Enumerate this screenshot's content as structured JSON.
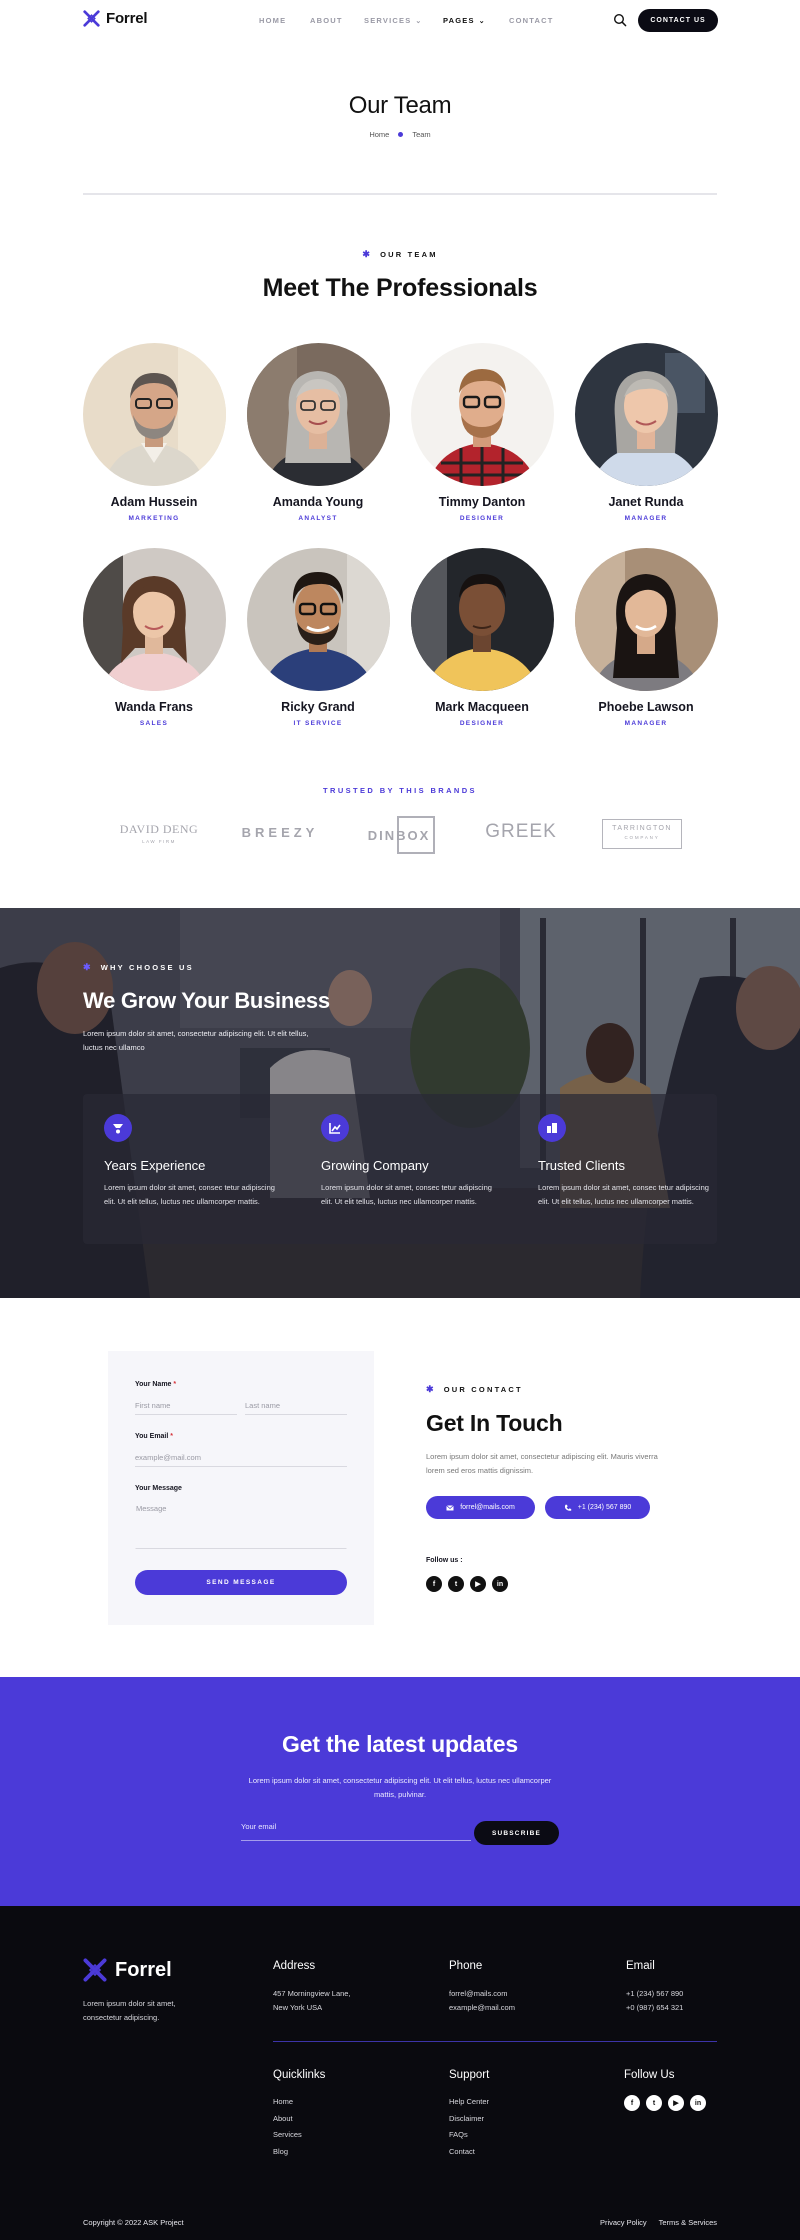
{
  "header": {
    "logo_text": "Forrel",
    "nav": [
      {
        "label": "HOME",
        "dropdown": false,
        "active": false
      },
      {
        "label": "ABOUT",
        "dropdown": false,
        "active": false
      },
      {
        "label": "SERVICES",
        "dropdown": true,
        "active": false
      },
      {
        "label": "PAGES",
        "dropdown": true,
        "active": true
      },
      {
        "label": "CONTACT",
        "dropdown": false,
        "active": false
      }
    ],
    "contact_button": "CONTACT US"
  },
  "page_title": {
    "title": "Our Team",
    "breadcrumb": [
      "Home",
      "Team"
    ]
  },
  "team": {
    "tag": "OUR TEAM",
    "heading": "Meet The Professionals",
    "members": [
      {
        "name": "Adam Hussein",
        "role": "MARKETING"
      },
      {
        "name": "Amanda Young",
        "role": "ANALYST"
      },
      {
        "name": "Timmy Danton",
        "role": "DESIGNER"
      },
      {
        "name": "Janet Runda",
        "role": "MANAGER"
      },
      {
        "name": "Wanda Frans",
        "role": "SALES"
      },
      {
        "name": "Ricky Grand",
        "role": "IT SERVICE"
      },
      {
        "name": "Mark Macqueen",
        "role": "DESIGNER"
      },
      {
        "name": "Phoebe Lawson",
        "role": "MANAGER"
      }
    ]
  },
  "brands": {
    "title": "TRUSTED BY THIS BRANDS",
    "items": [
      {
        "name": "DAVID DENG",
        "sub": "LAW FIRM"
      },
      {
        "name": "BREEZY",
        "sub": ""
      },
      {
        "name": "DINBOX",
        "sub": ""
      },
      {
        "name": "GREEK",
        "sub": ""
      },
      {
        "name": "TARRINGTON",
        "sub": "COMPANY"
      }
    ]
  },
  "why": {
    "tag": "WHY CHOOSE US",
    "heading": "We Grow Your Business",
    "subtitle": "Lorem ipsum dolor sit amet, consectetur adipiscing elit. Ut elit tellus, luctus nec ullamco",
    "features": [
      {
        "title": "Years Experience",
        "text": "Lorem ipsum dolor sit amet, consec tetur adipiscing elit. Ut elit tellus, luctus nec ullamcorper mattis.",
        "icon": "experience-icon"
      },
      {
        "title": "Growing Company",
        "text": "Lorem ipsum dolor sit amet, consec tetur adipiscing elit. Ut elit tellus, luctus nec ullamcorper mattis.",
        "icon": "growth-chart-icon"
      },
      {
        "title": "Trusted Clients",
        "text": "Lorem ipsum dolor sit amet, consec tetur adipiscing elit. Ut elit tellus, luctus nec ullamcorper mattis.",
        "icon": "clients-icon"
      }
    ]
  },
  "contact_form": {
    "name_label": "Your Name",
    "first_placeholder": "First name",
    "last_placeholder": "Last name",
    "email_label": "You Email",
    "email_placeholder": "example@mail.com",
    "message_label": "Your Message",
    "message_placeholder": "Message",
    "required_mark": "*",
    "send_button": "SEND MESSAGE"
  },
  "contact_info": {
    "tag": "OUR CONTACT",
    "heading": "Get In Touch",
    "text": "Lorem ipsum dolor sit amet, consectetur adipiscing elit. Mauris viverra lorem sed eros mattis dignissim.",
    "email": "forrel@mails.com",
    "phone": "+1 (234) 567 890",
    "follow_label": "Follow us :",
    "socials": [
      "facebook-icon",
      "twitter-icon",
      "youtube-icon",
      "linkedin-icon"
    ]
  },
  "newsletter": {
    "heading": "Get the latest updates",
    "text": "Lorem ipsum dolor sit amet, consectetur adipiscing elit. Ut elit tellus, luctus nec ullamcorper mattis, pulvinar.",
    "email_placeholder": "Your email",
    "button": "SUBSCRIBE"
  },
  "footer": {
    "logo_text": "Forrel",
    "description": "Lorem ipsum dolor sit amet, consectetur adipiscing.",
    "address_title": "Address",
    "address_lines": [
      "457 Morningview Lane,",
      "New York USA"
    ],
    "phone_title": "Phone",
    "phone_lines": [
      "forrel@mails.com",
      "example@mail.com"
    ],
    "email_title": "Email",
    "email_lines": [
      "+1 (234) 567 890",
      "+0 (987) 654 321"
    ],
    "quicklinks_title": "Quicklinks",
    "quicklinks": [
      "Home",
      "About",
      "Services",
      "Blog"
    ],
    "support_title": "Support",
    "support": [
      "Help Center",
      "Disclaimer",
      "FAQs",
      "Contact"
    ],
    "follow_title": "Follow Us",
    "copyright": "Copyright © 2022 ASK Project",
    "bottom_links": [
      "Privacy Policy",
      "Terms & Services"
    ]
  },
  "colors": {
    "accent": "#4b3ad8",
    "dark": "#0a0a0f",
    "form_bg": "#f6f6fa"
  }
}
